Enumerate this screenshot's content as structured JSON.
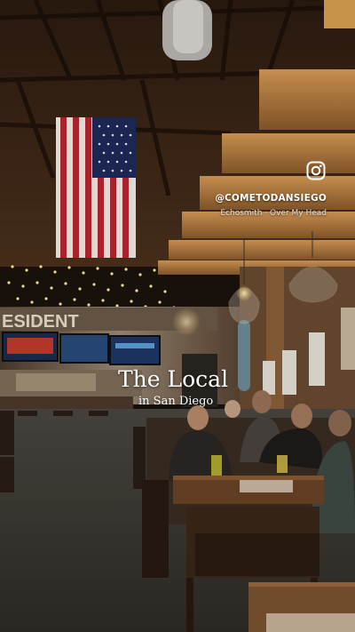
{
  "overlay": {
    "handle": "@COMETODANSIEGO",
    "music": "Echosmith · Over My Head",
    "title": "The Local",
    "subtitle": "in San Diego",
    "instagram_icon": "instagram-icon"
  },
  "scene": {
    "sign_text": "ESIDENT",
    "flag": "american-flag"
  },
  "colors": {
    "wood": "#c28a4a",
    "ceiling": "#2a1a10",
    "wall": "#8a7a68",
    "floor": "#3e3a34",
    "text": "#ffffff"
  }
}
